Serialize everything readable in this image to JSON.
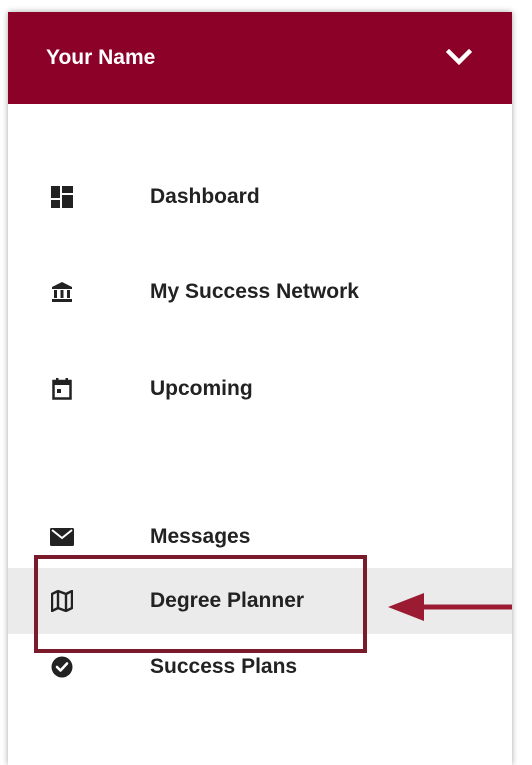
{
  "header": {
    "name": "Your Name",
    "brand_color": "#8b0128",
    "dropdown_icon": "chevron-down-icon"
  },
  "nav": {
    "items": [
      {
        "label": "Dashboard",
        "icon": "dashboard-icon"
      },
      {
        "label": "My Success Network",
        "icon": "institution-icon"
      },
      {
        "label": "Upcoming",
        "icon": "calendar-icon"
      },
      {
        "label": "Messages",
        "icon": "envelope-icon"
      },
      {
        "label": "Degree Planner",
        "icon": "map-icon",
        "active": true
      },
      {
        "label": "Success Plans",
        "icon": "check-circle-icon"
      }
    ]
  },
  "annotation": {
    "color": "#9b1b33",
    "target": "Degree Planner"
  }
}
